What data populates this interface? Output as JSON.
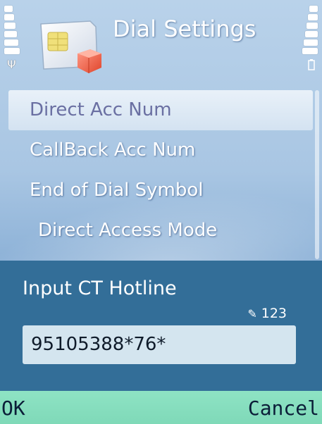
{
  "header": {
    "title": "Dial Settings",
    "icon": "sim-card-icon"
  },
  "menu": {
    "items": [
      {
        "label": "Direct Acc Num",
        "selected": true
      },
      {
        "label": "CallBack Acc Num",
        "selected": false
      },
      {
        "label": "End of Dial Symbol",
        "selected": false
      },
      {
        "label": "Direct Access Mode",
        "selected": false
      }
    ]
  },
  "dialog": {
    "title": "Input CT Hotline",
    "input_mode": "123",
    "input_value": "95105388*76*"
  },
  "softkeys": {
    "left": "OK",
    "right": "Cancel"
  },
  "colors": {
    "background": "#a9c6e3",
    "dialog": "#336e98",
    "softkey_bar": "#8ee3c4",
    "selected_text": "#6a6fa2"
  }
}
